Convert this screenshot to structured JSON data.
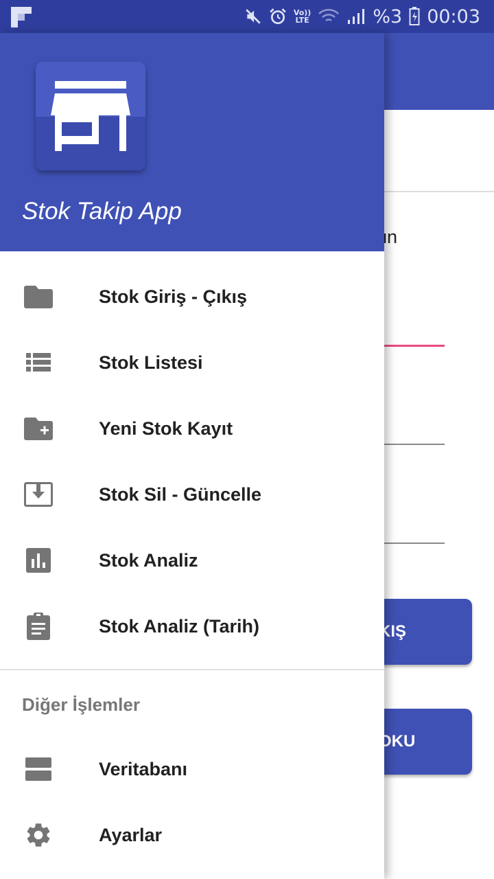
{
  "status_bar": {
    "battery": "%3",
    "time": "00:03",
    "network": "LTE",
    "icons": [
      "flipboard-icon",
      "mute-icon",
      "alarm-icon",
      "volte-icon",
      "wifi-icon",
      "signal-icon",
      "battery-icon"
    ]
  },
  "background": {
    "partial_label": "rün",
    "button1_label": "KIŞ",
    "button2_label": "OKU"
  },
  "drawer": {
    "app_title": "Stok Takip App",
    "items": [
      {
        "label": "Stok Giriş - Çıkış",
        "icon": "folder-icon"
      },
      {
        "label": "Stok Listesi",
        "icon": "list-icon"
      },
      {
        "label": "Yeni Stok Kayıt",
        "icon": "folder-add-icon"
      },
      {
        "label": "Stok Sil - Güncelle",
        "icon": "download-box-icon"
      },
      {
        "label": "Stok Analiz",
        "icon": "bar-chart-icon"
      },
      {
        "label": "Stok Analiz (Tarih)",
        "icon": "clipboard-icon"
      }
    ],
    "section_title": "Diğer İşlemler",
    "other_items": [
      {
        "label": "Veritabanı",
        "icon": "storage-icon"
      },
      {
        "label": "Ayarlar",
        "icon": "gear-icon"
      }
    ]
  },
  "colors": {
    "primary": "#3f51b5",
    "primary_dark": "#2f3e9e",
    "accent": "#e94b7f",
    "icon_gray": "#757575"
  }
}
